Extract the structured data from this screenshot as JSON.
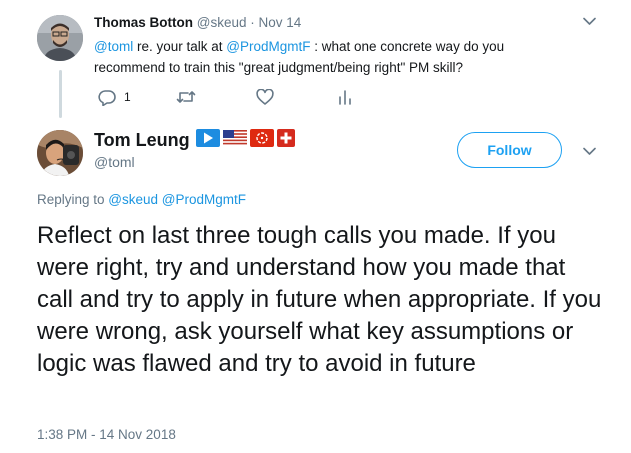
{
  "parent_tweet": {
    "author_name": "Thomas Botton",
    "author_handle": "@skeud",
    "separator": " · ",
    "date": "Nov 14",
    "text": {
      "mention1": "@toml",
      "part1": " re. your talk at ",
      "mention2": "@ProdMgmtF",
      "part2": " : what one concrete way do you recommend to train this \"great judgment/being right\" PM skill?"
    },
    "reply_count": "1",
    "icons": {
      "caret": "chevron-down-icon",
      "reply": "reply-icon",
      "retweet": "retweet-icon",
      "like": "heart-icon",
      "analytics": "analytics-icon"
    }
  },
  "main_tweet": {
    "author_name": "Tom Leung",
    "author_handle": "@toml",
    "badges": [
      "play-icon",
      "us-flag-icon",
      "hong-kong-flag-icon",
      "swiss-flag-icon"
    ],
    "follow_label": "Follow",
    "replying_prefix": "Replying to ",
    "replying_to": "@skeud @ProdMgmtF",
    "text": "Reflect on last three tough calls you made. If you were right, try and understand how you made that call and try to apply in future when appropriate. If you were wrong, ask yourself what key assumptions or logic was flawed and try to avoid in future",
    "timestamp": "1:38 PM - 14 Nov 2018"
  },
  "colors": {
    "link": "#1b95e0",
    "accent": "#1da1f2",
    "muted": "#657786",
    "text": "#14171a",
    "thread_line": "#cfd9de"
  }
}
